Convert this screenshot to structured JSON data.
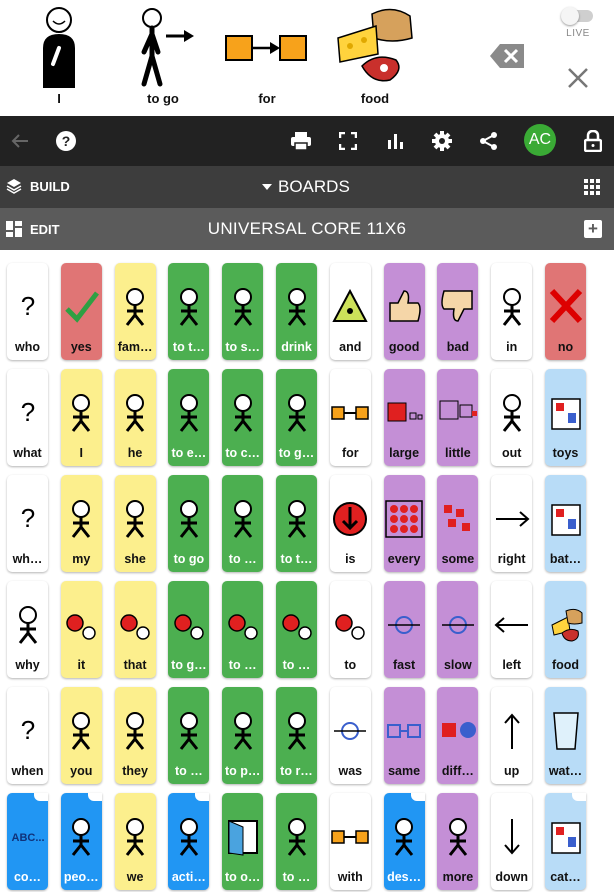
{
  "sentence": {
    "words": [
      {
        "label": "I",
        "icon": "person-pointing-self-icon"
      },
      {
        "label": "to go",
        "icon": "person-walking-arrow-icon"
      },
      {
        "label": "for",
        "icon": "boxes-arrow-icon"
      },
      {
        "label": "food",
        "icon": "food-group-icon"
      }
    ],
    "live_label": "LIVE"
  },
  "toolbar": {
    "avatar_initials": "AC"
  },
  "build_bar": {
    "build_label": "BUILD",
    "boards_label": "BOARDS"
  },
  "edit_bar": {
    "edit_label": "EDIT",
    "board_title": "UNIVERSAL CORE 11X6",
    "add_symbol": "+"
  },
  "colors": {
    "green": "#4caf50",
    "yellow": "#fcef8d",
    "purple": "#c48fd6",
    "red": "#e07575",
    "blue": "#2196f3",
    "lightblue": "#b8dcf7",
    "white": "#ffffff"
  },
  "board": {
    "tiles": [
      {
        "label": "who",
        "color": "white",
        "icon": "question-person-icon"
      },
      {
        "label": "yes",
        "color": "red",
        "icon": "checkmark-icon"
      },
      {
        "label": "fam…",
        "color": "yellow",
        "icon": "family-icon"
      },
      {
        "label": "to t…",
        "color": "green",
        "icon": "speech-bubble-person-icon"
      },
      {
        "label": "to s…",
        "color": "green",
        "icon": "person-saying-icon"
      },
      {
        "label": "drink",
        "color": "green",
        "icon": "person-drinking-icon"
      },
      {
        "label": "and",
        "color": "white",
        "icon": "triangle-dot-icon"
      },
      {
        "label": "good",
        "color": "purple",
        "icon": "thumbs-up-icon"
      },
      {
        "label": "bad",
        "color": "purple",
        "icon": "thumbs-down-icon"
      },
      {
        "label": "in",
        "color": "white",
        "icon": "arrow-into-box-icon"
      },
      {
        "label": "no",
        "color": "red",
        "icon": "cross-icon"
      },
      {
        "label": "what",
        "color": "white",
        "icon": "question-square-icon"
      },
      {
        "label": "I",
        "color": "yellow",
        "icon": "person-pointing-self-icon"
      },
      {
        "label": "he",
        "color": "yellow",
        "icon": "person-he-icon"
      },
      {
        "label": "to e…",
        "color": "green",
        "icon": "person-eating-icon"
      },
      {
        "label": "to c…",
        "color": "green",
        "icon": "people-come-icon"
      },
      {
        "label": "to g…",
        "color": "green",
        "icon": "hand-giving-icon"
      },
      {
        "label": "for",
        "color": "white",
        "icon": "boxes-arrow-icon"
      },
      {
        "label": "large",
        "color": "purple",
        "icon": "large-square-icon"
      },
      {
        "label": "little",
        "color": "purple",
        "icon": "little-square-icon"
      },
      {
        "label": "out",
        "color": "white",
        "icon": "arrow-out-box-icon"
      },
      {
        "label": "toys",
        "color": "lightblue",
        "icon": "toy-shelf-icon"
      },
      {
        "label": "wh…",
        "color": "white",
        "icon": "question-house-icon"
      },
      {
        "label": "my",
        "color": "yellow",
        "icon": "person-my-icon"
      },
      {
        "label": "she",
        "color": "yellow",
        "icon": "person-she-icon"
      },
      {
        "label": "to go",
        "color": "green",
        "icon": "person-walking-arrow-icon"
      },
      {
        "label": "to …",
        "color": "green",
        "icon": "person-standing-icon"
      },
      {
        "label": "to t…",
        "color": "green",
        "icon": "people-talking-icon"
      },
      {
        "label": "is",
        "color": "white",
        "icon": "red-circle-arrow-icon"
      },
      {
        "label": "every",
        "color": "purple",
        "icon": "many-dots-icon"
      },
      {
        "label": "some",
        "color": "purple",
        "icon": "some-pieces-icon"
      },
      {
        "label": "right",
        "color": "white",
        "icon": "arrow-right-icon"
      },
      {
        "label": "bat…",
        "color": "lightblue",
        "icon": "toilet-icon"
      },
      {
        "label": "why",
        "color": "white",
        "icon": "person-question-icon"
      },
      {
        "label": "it",
        "color": "yellow",
        "icon": "red-ball-it-icon"
      },
      {
        "label": "that",
        "color": "yellow",
        "icon": "ball-that-icon"
      },
      {
        "label": "to g…",
        "color": "green",
        "icon": "people-ball-give-icon"
      },
      {
        "label": "to …",
        "color": "green",
        "icon": "hands-ball-icon"
      },
      {
        "label": "to …",
        "color": "green",
        "icon": "ball-arrow-icon"
      },
      {
        "label": "to",
        "color": "white",
        "icon": "hand-to-icon"
      },
      {
        "label": "fast",
        "color": "purple",
        "icon": "fast-runner-icon"
      },
      {
        "label": "slow",
        "color": "purple",
        "icon": "snail-arrow-icon"
      },
      {
        "label": "left",
        "color": "white",
        "icon": "arrow-left-icon"
      },
      {
        "label": "food",
        "color": "lightblue",
        "icon": "food-group-icon"
      },
      {
        "label": "when",
        "color": "white",
        "icon": "question-clock-icon"
      },
      {
        "label": "you",
        "color": "yellow",
        "icon": "person-you-icon"
      },
      {
        "label": "they",
        "color": "yellow",
        "icon": "people-they-icon"
      },
      {
        "label": "to …",
        "color": "green",
        "icon": "person-device-icon"
      },
      {
        "label": "to p…",
        "color": "green",
        "icon": "hand-put-icon"
      },
      {
        "label": "to r…",
        "color": "green",
        "icon": "person-relax-icon"
      },
      {
        "label": "was",
        "color": "white",
        "icon": "circle-arrow-was-icon"
      },
      {
        "label": "same",
        "color": "purple",
        "icon": "two-squares-same-icon"
      },
      {
        "label": "diff…",
        "color": "purple",
        "icon": "square-circle-icon"
      },
      {
        "label": "up",
        "color": "white",
        "icon": "arrow-up-icon"
      },
      {
        "label": "wat…",
        "color": "lightblue",
        "icon": "water-glass-icon"
      },
      {
        "label": "co…",
        "color": "blue",
        "folder": true,
        "icon": "abc-text-icon"
      },
      {
        "label": "peo…",
        "color": "blue",
        "folder": true,
        "icon": "group-people-icon"
      },
      {
        "label": "we",
        "color": "yellow",
        "icon": "people-we-icon"
      },
      {
        "label": "acti…",
        "color": "blue",
        "folder": true,
        "icon": "activities-icon"
      },
      {
        "label": "to o…",
        "color": "green",
        "icon": "door-open-icon"
      },
      {
        "label": "to …",
        "color": "green",
        "icon": "person-look-icon"
      },
      {
        "label": "with",
        "color": "white",
        "icon": "linked-boxes-icon"
      },
      {
        "label": "des…",
        "color": "blue",
        "folder": true,
        "icon": "describe-faces-icon"
      },
      {
        "label": "more",
        "color": "purple",
        "icon": "person-more-icon"
      },
      {
        "label": "down",
        "color": "white",
        "icon": "arrow-down-icon"
      },
      {
        "label": "cat…",
        "color": "lightblue",
        "folder": true,
        "icon": "categories-icon"
      }
    ]
  }
}
